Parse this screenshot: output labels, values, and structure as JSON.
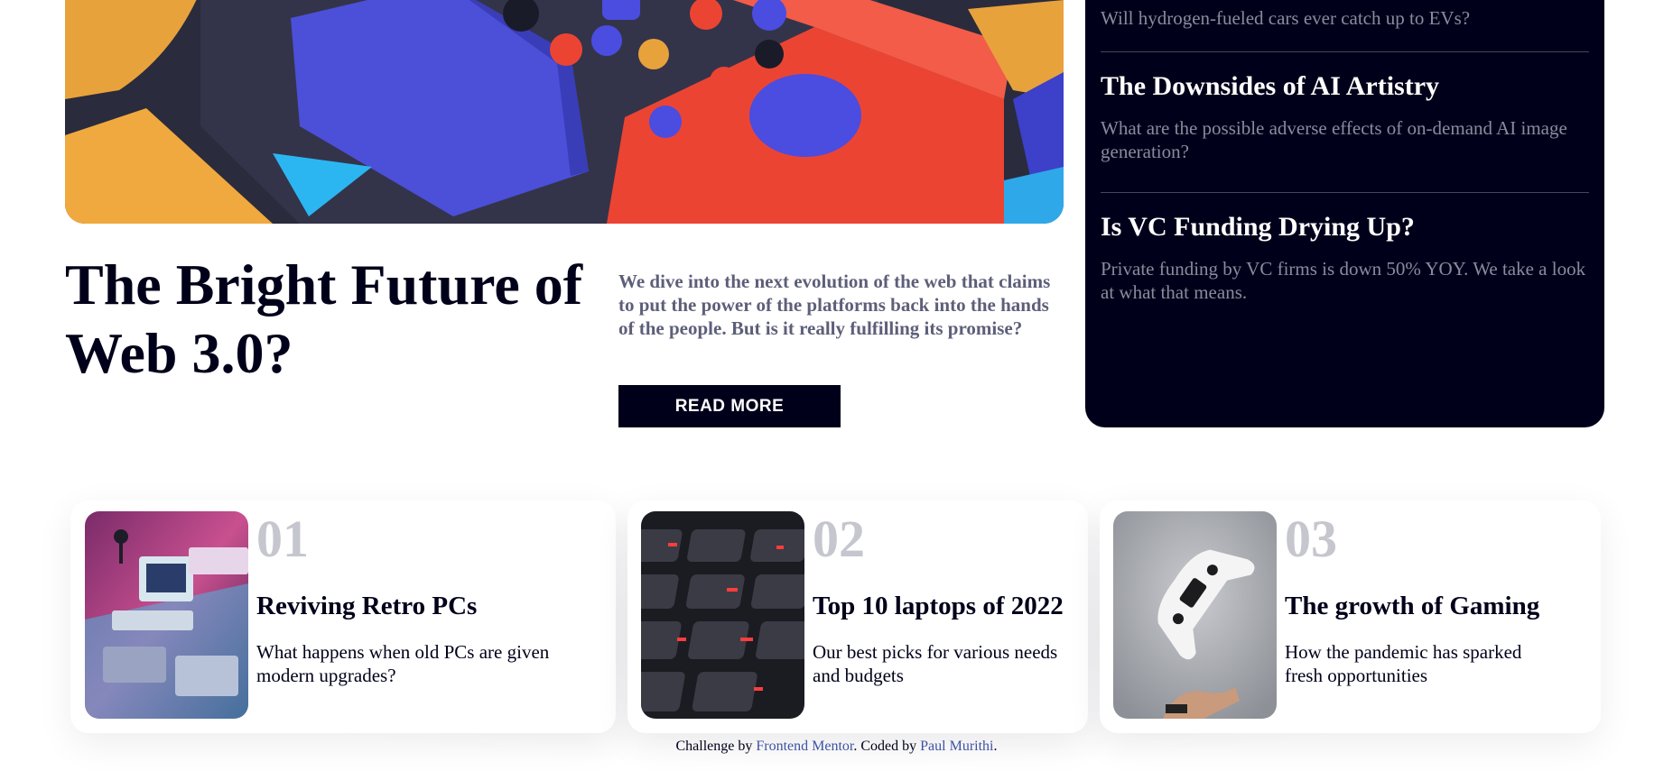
{
  "hero": {
    "title": "The Bright Future of Web 3.0?",
    "description": "We dive into the next evolution of the web that claims to put the power of the platforms back into the hands of the people. But is it really fulfilling its promise?",
    "button_label": "Read more"
  },
  "new_panel": {
    "items": [
      {
        "title": "",
        "description": "Will hydrogen-fueled cars ever catch up to EVs?"
      },
      {
        "title": "The Downsides of AI Artistry",
        "description": "What are the possible adverse effects of on-demand AI image generation?"
      },
      {
        "title": "Is VC Funding Drying Up?",
        "description": "Private funding by VC firms is down 50% YOY. We take a look at what that means."
      }
    ]
  },
  "cards": [
    {
      "number": "01",
      "title": "Reviving Retro PCs",
      "description": "What happens when old PCs are given modern upgrades?",
      "thumb_icon": "retro-pc-icon"
    },
    {
      "number": "02",
      "title": "Top 10 laptops of 2022",
      "description": "Our best picks for various needs and budgets",
      "thumb_icon": "keyboard-icon"
    },
    {
      "number": "03",
      "title": "The growth of Gaming",
      "description": "How the pandemic has sparked fresh opportunities",
      "thumb_icon": "gamepad-icon"
    }
  ],
  "attribution": {
    "prefix": "Challenge by",
    "frontend_mentor": "Frontend Mentor",
    "middle": ". Coded by",
    "author": "Paul Murithi",
    "suffix": "."
  },
  "colors": {
    "dark_navy": "#00001a",
    "grayish_blue": "#5d5f79",
    "grayish_number": "#c5c6ce",
    "soft_orange": "#e9ab53",
    "soft_red": "#f15e50",
    "link_blue": "#3e52a3"
  }
}
